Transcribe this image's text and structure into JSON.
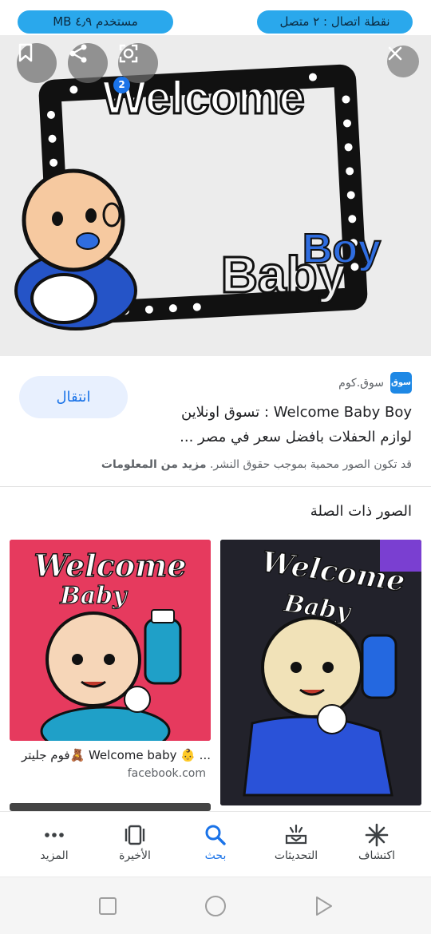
{
  "status_bar": {
    "data_used": "مستخدم ٤٫٩ MB",
    "hotspot": "نقطة اتصال : ٢ متصل"
  },
  "hero": {
    "share_badge_count": "2",
    "image_text": {
      "welcome": "Welcome",
      "baby": "Baby",
      "boy": "Boy"
    },
    "icons": [
      "bookmark-icon",
      "share-icon",
      "lens-icon",
      "close-icon"
    ]
  },
  "result": {
    "source_logo_text": "سوق",
    "source_name": "سوق.كوم",
    "title_line1": "Welcome Baby Boy : تسوق اونلاين",
    "title_line2": "لوازم الحفلات بافضل سعر في مصر ...",
    "visit_label": "انتقال",
    "copyright_text": "قد تكون الصور محمية بموجب حقوق النشر.",
    "more_info_label": "مزيد من المعلومات"
  },
  "related": {
    "title": "الصور ذات الصلة",
    "items": [
      {
        "caption": "... 👶 Welcome baby 🧸فوم جليتر",
        "domain": "facebook.com",
        "image_text_1": "Welcome",
        "image_text_2": "Baby"
      },
      {
        "image_text_1": "Welcome",
        "image_text_2": "Baby"
      }
    ]
  },
  "bottom_nav": {
    "items": [
      {
        "label": "المزيد",
        "icon": "more-icon"
      },
      {
        "label": "الأخيرة",
        "icon": "recent-icon"
      },
      {
        "label": "بحث",
        "icon": "search-icon",
        "active": true
      },
      {
        "label": "التحديثات",
        "icon": "updates-icon"
      },
      {
        "label": "اكتشاف",
        "icon": "discover-icon"
      }
    ]
  },
  "colors": {
    "accent": "#1a73e8",
    "pill": "#2aa8ec",
    "visit_bg": "#e8f0fe"
  }
}
